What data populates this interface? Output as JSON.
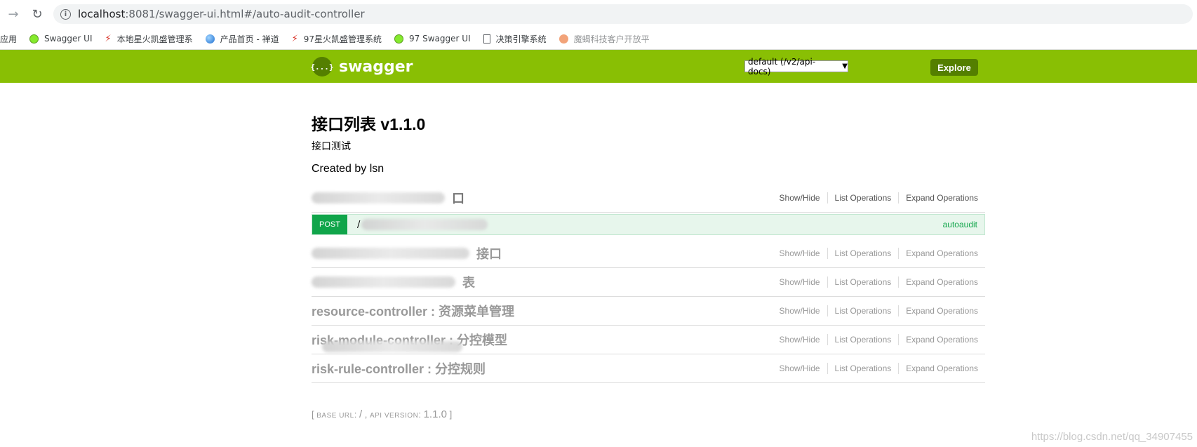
{
  "browser": {
    "url_host": "localhost",
    "url_rest": ":8081/swagger-ui.html#/auto-audit-controller",
    "bookmarks": [
      {
        "label": "应用",
        "icon": "apps-icon"
      },
      {
        "label": "Swagger UI",
        "icon": "swagger-icon"
      },
      {
        "label": "本地星火凯盛管理系",
        "icon": "red-logo-icon"
      },
      {
        "label": "产品首页 - 禅道",
        "icon": "globe-icon"
      },
      {
        "label": "97星火凯盛管理系统",
        "icon": "red-logo-icon"
      },
      {
        "label": "97 Swagger UI",
        "icon": "swagger-icon"
      },
      {
        "label": "决策引擎系统",
        "icon": "document-icon"
      },
      {
        "label": "魔蝎科技客户开放平",
        "icon": "orange-logo-icon"
      }
    ]
  },
  "header": {
    "logo_symbol": "{...}",
    "logo_text": "swagger",
    "spec_select_value": "default (/v2/api-docs)",
    "explore_label": "Explore",
    "brand_color": "#89bf04"
  },
  "info": {
    "title": "接口列表 v1.1.0",
    "description": "接口测试",
    "created_by": "Created by lsn"
  },
  "resources": [
    {
      "name": "口",
      "name_visible": "...接口",
      "show_hide": "Show/Hide",
      "list_ops": "List Operations",
      "expand_ops": "Expand Operations"
    },
    {
      "name": "接口",
      "show_hide": "Show/Hide",
      "list_ops": "List Operations",
      "expand_ops": "Expand Operations"
    },
    {
      "name": "表",
      "show_hide": "Show/Hide",
      "list_ops": "List Operations",
      "expand_ops": "Expand Operations"
    },
    {
      "name": "resource-controller : 资源菜单管理",
      "show_hide": "Show/Hide",
      "list_ops": "List Operations",
      "expand_ops": "Expand Operations"
    },
    {
      "name": "risk-module-controller : 分控模型",
      "show_hide": "Show/Hide",
      "list_ops": "List Operations",
      "expand_ops": "Expand Operations"
    },
    {
      "name": "risk-rule-controller : 分控规则",
      "show_hide": "Show/Hide",
      "list_ops": "List Operations",
      "expand_ops": "Expand Operations"
    }
  ],
  "operation": {
    "method": "POST",
    "path": "/",
    "tag": "autoaudit"
  },
  "footer": {
    "base_url_label": "BASE URL",
    "base_url_value": "/",
    "api_version_label": "API VERSION",
    "api_version_value": "1.1.0"
  },
  "watermark": "https://blog.csdn.net/qq_34907455"
}
